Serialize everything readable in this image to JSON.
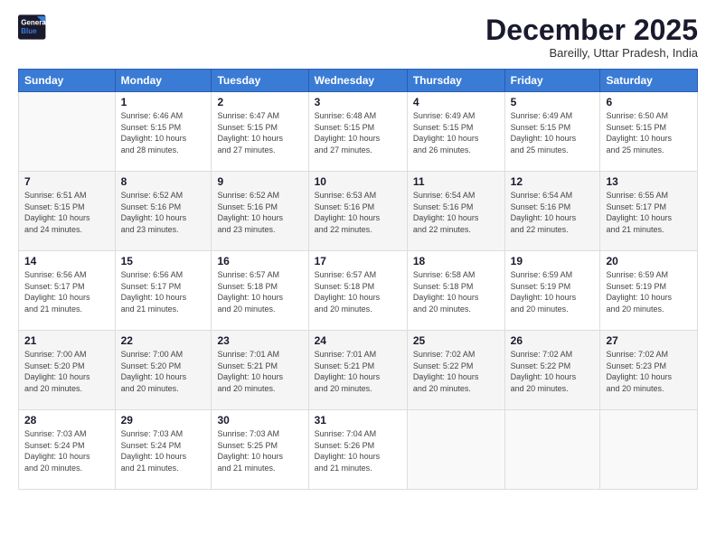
{
  "logo": {
    "line1": "General",
    "line2": "Blue"
  },
  "title": "December 2025",
  "subtitle": "Bareilly, Uttar Pradesh, India",
  "days_header": [
    "Sunday",
    "Monday",
    "Tuesday",
    "Wednesday",
    "Thursday",
    "Friday",
    "Saturday"
  ],
  "weeks": [
    [
      {
        "num": "",
        "info": ""
      },
      {
        "num": "1",
        "info": "Sunrise: 6:46 AM\nSunset: 5:15 PM\nDaylight: 10 hours\nand 28 minutes."
      },
      {
        "num": "2",
        "info": "Sunrise: 6:47 AM\nSunset: 5:15 PM\nDaylight: 10 hours\nand 27 minutes."
      },
      {
        "num": "3",
        "info": "Sunrise: 6:48 AM\nSunset: 5:15 PM\nDaylight: 10 hours\nand 27 minutes."
      },
      {
        "num": "4",
        "info": "Sunrise: 6:49 AM\nSunset: 5:15 PM\nDaylight: 10 hours\nand 26 minutes."
      },
      {
        "num": "5",
        "info": "Sunrise: 6:49 AM\nSunset: 5:15 PM\nDaylight: 10 hours\nand 25 minutes."
      },
      {
        "num": "6",
        "info": "Sunrise: 6:50 AM\nSunset: 5:15 PM\nDaylight: 10 hours\nand 25 minutes."
      }
    ],
    [
      {
        "num": "7",
        "info": "Sunrise: 6:51 AM\nSunset: 5:15 PM\nDaylight: 10 hours\nand 24 minutes."
      },
      {
        "num": "8",
        "info": "Sunrise: 6:52 AM\nSunset: 5:16 PM\nDaylight: 10 hours\nand 23 minutes."
      },
      {
        "num": "9",
        "info": "Sunrise: 6:52 AM\nSunset: 5:16 PM\nDaylight: 10 hours\nand 23 minutes."
      },
      {
        "num": "10",
        "info": "Sunrise: 6:53 AM\nSunset: 5:16 PM\nDaylight: 10 hours\nand 22 minutes."
      },
      {
        "num": "11",
        "info": "Sunrise: 6:54 AM\nSunset: 5:16 PM\nDaylight: 10 hours\nand 22 minutes."
      },
      {
        "num": "12",
        "info": "Sunrise: 6:54 AM\nSunset: 5:16 PM\nDaylight: 10 hours\nand 22 minutes."
      },
      {
        "num": "13",
        "info": "Sunrise: 6:55 AM\nSunset: 5:17 PM\nDaylight: 10 hours\nand 21 minutes."
      }
    ],
    [
      {
        "num": "14",
        "info": "Sunrise: 6:56 AM\nSunset: 5:17 PM\nDaylight: 10 hours\nand 21 minutes."
      },
      {
        "num": "15",
        "info": "Sunrise: 6:56 AM\nSunset: 5:17 PM\nDaylight: 10 hours\nand 21 minutes."
      },
      {
        "num": "16",
        "info": "Sunrise: 6:57 AM\nSunset: 5:18 PM\nDaylight: 10 hours\nand 20 minutes."
      },
      {
        "num": "17",
        "info": "Sunrise: 6:57 AM\nSunset: 5:18 PM\nDaylight: 10 hours\nand 20 minutes."
      },
      {
        "num": "18",
        "info": "Sunrise: 6:58 AM\nSunset: 5:18 PM\nDaylight: 10 hours\nand 20 minutes."
      },
      {
        "num": "19",
        "info": "Sunrise: 6:59 AM\nSunset: 5:19 PM\nDaylight: 10 hours\nand 20 minutes."
      },
      {
        "num": "20",
        "info": "Sunrise: 6:59 AM\nSunset: 5:19 PM\nDaylight: 10 hours\nand 20 minutes."
      }
    ],
    [
      {
        "num": "21",
        "info": "Sunrise: 7:00 AM\nSunset: 5:20 PM\nDaylight: 10 hours\nand 20 minutes."
      },
      {
        "num": "22",
        "info": "Sunrise: 7:00 AM\nSunset: 5:20 PM\nDaylight: 10 hours\nand 20 minutes."
      },
      {
        "num": "23",
        "info": "Sunrise: 7:01 AM\nSunset: 5:21 PM\nDaylight: 10 hours\nand 20 minutes."
      },
      {
        "num": "24",
        "info": "Sunrise: 7:01 AM\nSunset: 5:21 PM\nDaylight: 10 hours\nand 20 minutes."
      },
      {
        "num": "25",
        "info": "Sunrise: 7:02 AM\nSunset: 5:22 PM\nDaylight: 10 hours\nand 20 minutes."
      },
      {
        "num": "26",
        "info": "Sunrise: 7:02 AM\nSunset: 5:22 PM\nDaylight: 10 hours\nand 20 minutes."
      },
      {
        "num": "27",
        "info": "Sunrise: 7:02 AM\nSunset: 5:23 PM\nDaylight: 10 hours\nand 20 minutes."
      }
    ],
    [
      {
        "num": "28",
        "info": "Sunrise: 7:03 AM\nSunset: 5:24 PM\nDaylight: 10 hours\nand 20 minutes."
      },
      {
        "num": "29",
        "info": "Sunrise: 7:03 AM\nSunset: 5:24 PM\nDaylight: 10 hours\nand 21 minutes."
      },
      {
        "num": "30",
        "info": "Sunrise: 7:03 AM\nSunset: 5:25 PM\nDaylight: 10 hours\nand 21 minutes."
      },
      {
        "num": "31",
        "info": "Sunrise: 7:04 AM\nSunset: 5:26 PM\nDaylight: 10 hours\nand 21 minutes."
      },
      {
        "num": "",
        "info": ""
      },
      {
        "num": "",
        "info": ""
      },
      {
        "num": "",
        "info": ""
      }
    ]
  ]
}
